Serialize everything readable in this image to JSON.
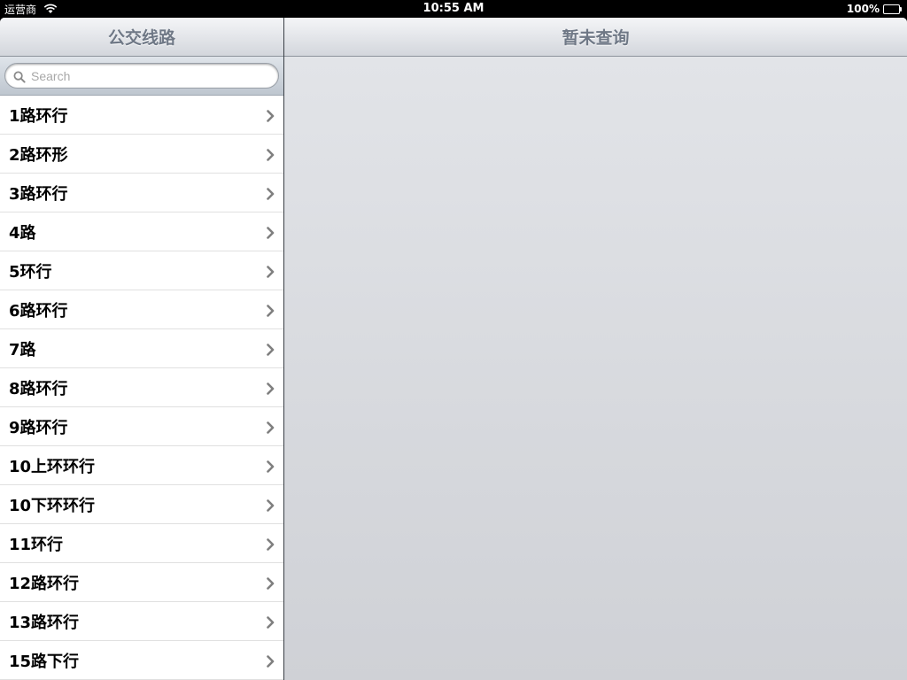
{
  "status_bar": {
    "carrier": "运营商",
    "time": "10:55 AM",
    "battery": "100%"
  },
  "master": {
    "title": "公交线路",
    "search": {
      "placeholder": "Search",
      "value": ""
    },
    "routes": [
      {
        "label": "1路环行"
      },
      {
        "label": "2路环形"
      },
      {
        "label": "3路环行"
      },
      {
        "label": "4路"
      },
      {
        "label": "5环行"
      },
      {
        "label": "6路环行"
      },
      {
        "label": "7路"
      },
      {
        "label": "8路环行"
      },
      {
        "label": "9路环行"
      },
      {
        "label": "10上环环行"
      },
      {
        "label": "10下环环行"
      },
      {
        "label": "11环行"
      },
      {
        "label": "12路环行"
      },
      {
        "label": "13路环行"
      },
      {
        "label": "15路下行"
      }
    ]
  },
  "detail": {
    "title": "暂未查询"
  },
  "icons": {
    "wifi": "wifi-icon",
    "battery": "battery-icon",
    "search": "search-icon",
    "disclosure": "chevron-right-icon"
  }
}
